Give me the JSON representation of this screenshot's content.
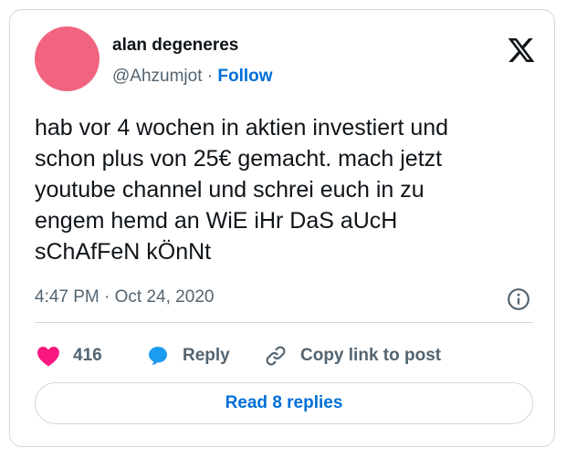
{
  "author": {
    "name": "alan degeneres",
    "handle": "@Ahzumjot",
    "separator": " · ",
    "follow_label": "Follow"
  },
  "tweet": {
    "lines": [
      "hab vor 4 wochen in aktien investiert und",
      "schon plus von 25€ gemacht. mach jetzt",
      "youtube channel und schrei euch in zu",
      "engem hemd an WiE iHr DaS aUcH",
      "sChAfFeN kÖnNt"
    ],
    "time": "4:47 PM",
    "date_separator": " · ",
    "date": "Oct 24, 2020"
  },
  "actions": {
    "like_count": "416",
    "reply_label": "Reply",
    "copy_label": "Copy link to post"
  },
  "read_replies_label": "Read 8 replies",
  "icons": {
    "logo": "x-logo-icon",
    "info": "info-icon",
    "like": "heart-icon",
    "reply": "speech-bubble-icon",
    "copy": "link-icon"
  },
  "colors": {
    "like": "#f91880",
    "reply": "#1d9bf0",
    "link_blue": "#006fd6",
    "avatar": "#f0647f"
  }
}
